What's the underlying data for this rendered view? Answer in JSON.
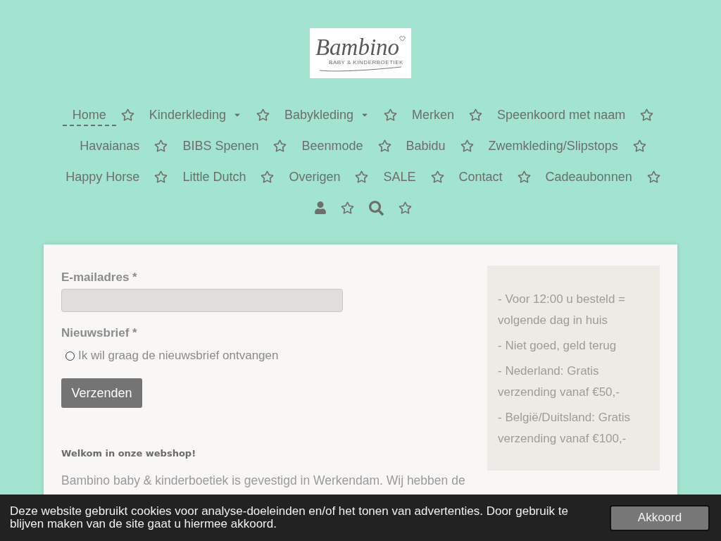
{
  "logo": {
    "name": "Bambino",
    "tagline": "BABY & KINDERBOETIEK"
  },
  "nav": [
    {
      "kind": "link",
      "label": "Home",
      "selected": true,
      "dropdown": false
    },
    {
      "kind": "link",
      "label": "Kinderkleding",
      "selected": false,
      "dropdown": true
    },
    {
      "kind": "link",
      "label": "Babykleding",
      "selected": false,
      "dropdown": true
    },
    {
      "kind": "link",
      "label": "Merken",
      "selected": false,
      "dropdown": false
    },
    {
      "kind": "link",
      "label": "Speenkoord met naam",
      "selected": false,
      "dropdown": false
    },
    {
      "kind": "link",
      "label": "Havaianas",
      "selected": false,
      "dropdown": false
    },
    {
      "kind": "link",
      "label": "BIBS Spenen",
      "selected": false,
      "dropdown": false
    },
    {
      "kind": "link",
      "label": "Beenmode",
      "selected": false,
      "dropdown": false
    },
    {
      "kind": "link",
      "label": "Babidu",
      "selected": false,
      "dropdown": false
    },
    {
      "kind": "link",
      "label": "Zwemkleding/Slipstops",
      "selected": false,
      "dropdown": false
    },
    {
      "kind": "link",
      "label": "Happy Horse",
      "selected": false,
      "dropdown": false
    },
    {
      "kind": "link",
      "label": "Little Dutch",
      "selected": false,
      "dropdown": false
    },
    {
      "kind": "link",
      "label": "Overigen",
      "selected": false,
      "dropdown": false
    },
    {
      "kind": "link",
      "label": "SALE",
      "selected": false,
      "dropdown": false
    },
    {
      "kind": "link",
      "label": "Contact",
      "selected": false,
      "dropdown": false
    },
    {
      "kind": "link",
      "label": "Cadeaubonnen",
      "selected": false,
      "dropdown": false
    },
    {
      "kind": "account",
      "selected": false
    },
    {
      "kind": "search",
      "selected": false
    }
  ],
  "form": {
    "email_label": "E-mailadres *",
    "newsletter_label": "Nieuwsbrief *",
    "newsletter_option": {
      "label": "Ik wil graag de nieuwsbrief ontvangen",
      "checked": false
    },
    "submit": "Verzenden"
  },
  "welcome": {
    "heading": "Welkom in onze webshop!",
    "text": "Bambino baby & kinderboetiek is gevestigd in Werkendam. Wij hebben de"
  },
  "sidebar": {
    "items": [
      "- Voor 12:00 u besteld = volgende dag in huis",
      "- Niet goed, geld terug",
      "- Nederland: Gratis verzending vanaf €50,-",
      "- België/Duitsland: Gratis verzending vanaf €100,-"
    ]
  },
  "cookie_bar": {
    "text": "Deze website gebruikt cookies voor analyse-doeleinden en/of het tonen van advertenties. Door gebruik te blijven maken van de site gaat u hiermee akkoord.",
    "button": "Akkoord"
  }
}
